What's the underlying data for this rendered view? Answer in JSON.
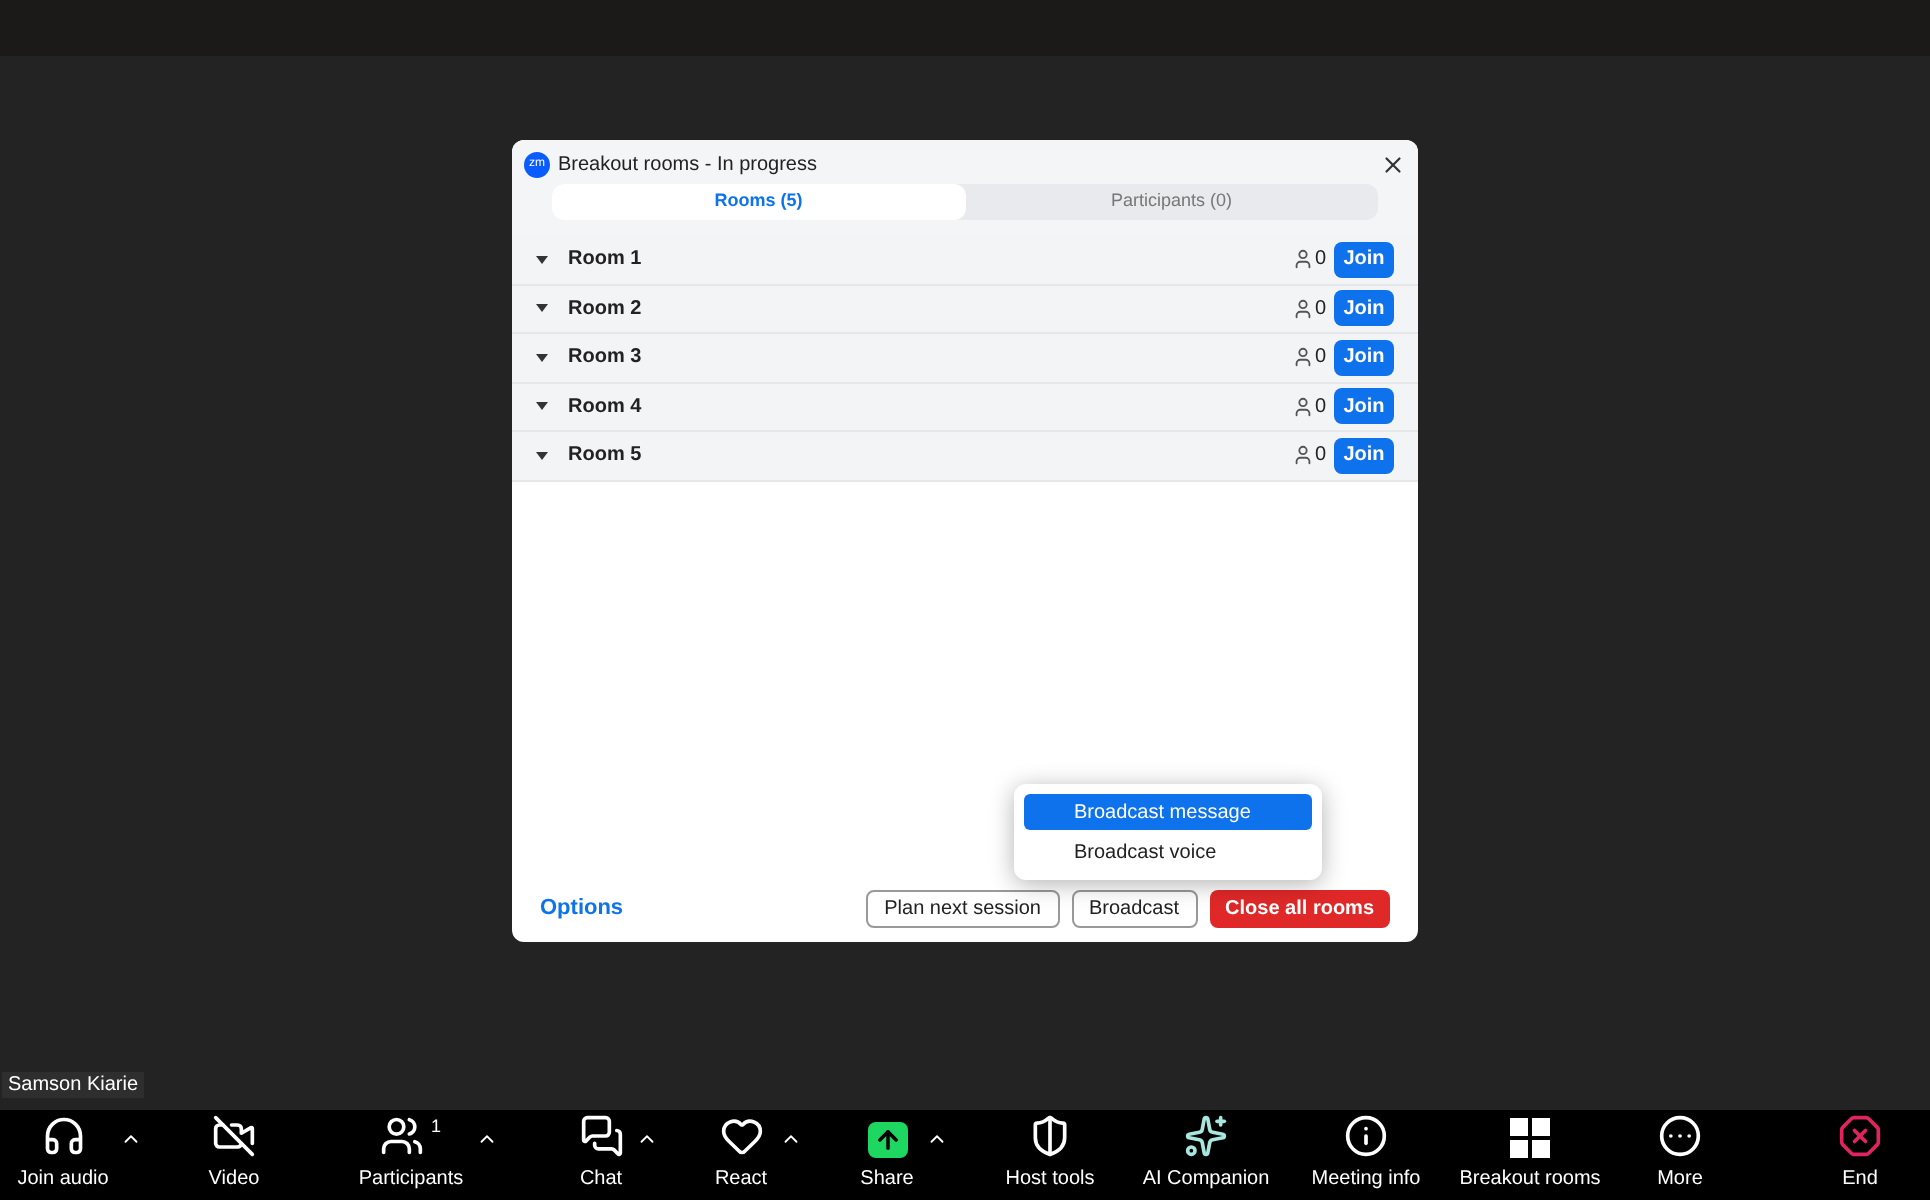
{
  "dialog": {
    "title": "Breakout rooms - In progress",
    "logo": "zm",
    "tabs": [
      {
        "label": "Rooms (5)",
        "selected": true
      },
      {
        "label": "Participants (0)",
        "selected": false
      }
    ],
    "rooms": [
      {
        "name": "Room 1",
        "count": "0",
        "action": "Join"
      },
      {
        "name": "Room 2",
        "count": "0",
        "action": "Join"
      },
      {
        "name": "Room 3",
        "count": "0",
        "action": "Join"
      },
      {
        "name": "Room 4",
        "count": "0",
        "action": "Join"
      },
      {
        "name": "Room 5",
        "count": "0",
        "action": "Join"
      }
    ],
    "broadcast_menu": [
      {
        "label": "Broadcast message",
        "selected": true
      },
      {
        "label": "Broadcast voice",
        "selected": false
      }
    ],
    "options_link": "Options",
    "buttons": [
      {
        "label": "Plan next session",
        "kind": "outline"
      },
      {
        "label": "Broadcast",
        "kind": "outline"
      },
      {
        "label": "Close all rooms",
        "kind": "danger"
      }
    ]
  },
  "name_tag": "Samson Kiarie",
  "toolbar": [
    {
      "label": "Join audio",
      "menu_caret": true
    },
    {
      "label": "Video",
      "menu_caret": false
    },
    {
      "label": "Participants",
      "badge": "1",
      "menu_caret": true
    },
    {
      "label": "Chat",
      "menu_caret": true
    },
    {
      "label": "React",
      "menu_caret": true
    },
    {
      "label": "Share",
      "menu_caret": true
    },
    {
      "label": "Host tools",
      "menu_caret": false
    },
    {
      "label": "AI Companion",
      "menu_caret": false
    },
    {
      "label": "Meeting info",
      "menu_caret": false
    },
    {
      "label": "Breakout rooms",
      "menu_caret": false
    },
    {
      "label": "More",
      "menu_caret": false
    },
    {
      "label": "End",
      "menu_caret": false
    }
  ]
}
